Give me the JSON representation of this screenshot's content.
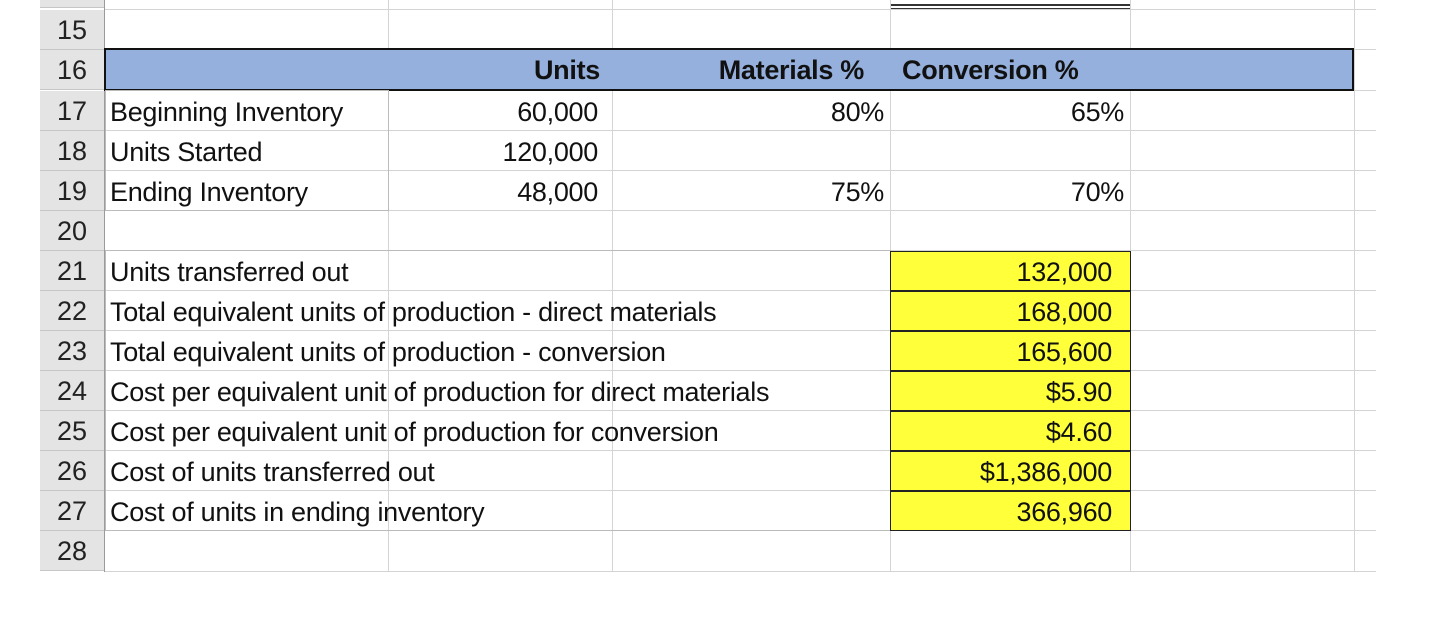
{
  "row_numbers": [
    "15",
    "16",
    "17",
    "18",
    "19",
    "20",
    "21",
    "22",
    "23",
    "24",
    "25",
    "26",
    "27",
    "28"
  ],
  "header": {
    "units": "Units",
    "materials_pct": "Materials %",
    "conversion_pct": "Conversion %"
  },
  "inventory_rows": [
    {
      "label": "Beginning Inventory",
      "units": "60,000",
      "materials": "80%",
      "conversion": "65%"
    },
    {
      "label": "Units Started",
      "units": "120,000",
      "materials": "",
      "conversion": ""
    },
    {
      "label": "Ending Inventory",
      "units": "48,000",
      "materials": "75%",
      "conversion": "70%"
    }
  ],
  "results": [
    {
      "label": "Units transferred out",
      "value": "132,000"
    },
    {
      "label": "Total equivalent units of production - direct materials",
      "value": "168,000"
    },
    {
      "label": "Total equivalent units of production - conversion",
      "value": "165,600"
    },
    {
      "label": "Cost per equivalent unit of production for direct materials",
      "value": "$5.90"
    },
    {
      "label": "Cost per equivalent unit of production for conversion",
      "value": "$4.60"
    },
    {
      "label": "Cost of units transferred out",
      "value": "$1,386,000"
    },
    {
      "label": "Cost of units in ending inventory",
      "value": "366,960"
    }
  ],
  "colors": {
    "header_band": "#95b0dc",
    "highlight": "#ffff3a",
    "row_header": "#e4e4e4"
  }
}
